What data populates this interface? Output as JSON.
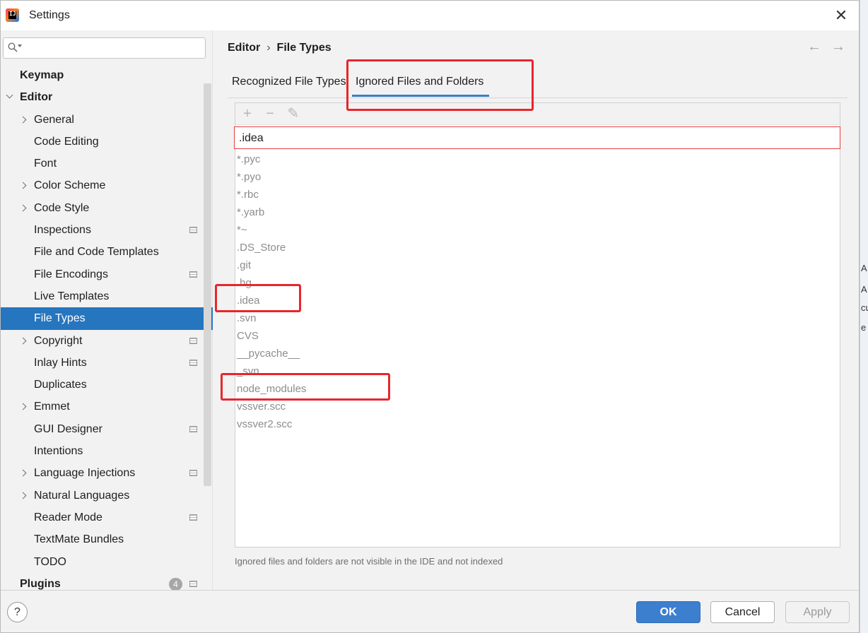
{
  "window": {
    "title": "Settings",
    "close_glyph": "✕"
  },
  "sidebar": {
    "search_placeholder": "",
    "items": [
      {
        "label": "Keymap",
        "bold": true,
        "level": 0,
        "chevron": "none",
        "scope": false
      },
      {
        "label": "Editor",
        "bold": true,
        "level": 0,
        "chevron": "down",
        "scope": false
      },
      {
        "label": "General",
        "level": 1,
        "chevron": "right",
        "scope": false
      },
      {
        "label": "Code Editing",
        "level": 1,
        "chevron": "none",
        "scope": false
      },
      {
        "label": "Font",
        "level": 1,
        "chevron": "none",
        "scope": false
      },
      {
        "label": "Color Scheme",
        "level": 1,
        "chevron": "right",
        "scope": false
      },
      {
        "label": "Code Style",
        "level": 1,
        "chevron": "right",
        "scope": false
      },
      {
        "label": "Inspections",
        "level": 1,
        "chevron": "none",
        "scope": true
      },
      {
        "label": "File and Code Templates",
        "level": 1,
        "chevron": "none",
        "scope": false
      },
      {
        "label": "File Encodings",
        "level": 1,
        "chevron": "none",
        "scope": true
      },
      {
        "label": "Live Templates",
        "level": 1,
        "chevron": "none",
        "scope": false
      },
      {
        "label": "File Types",
        "level": 1,
        "chevron": "none",
        "scope": false,
        "selected": true
      },
      {
        "label": "Copyright",
        "level": 1,
        "chevron": "right",
        "scope": true
      },
      {
        "label": "Inlay Hints",
        "level": 1,
        "chevron": "none",
        "scope": true
      },
      {
        "label": "Duplicates",
        "level": 1,
        "chevron": "none",
        "scope": false
      },
      {
        "label": "Emmet",
        "level": 1,
        "chevron": "right",
        "scope": false
      },
      {
        "label": "GUI Designer",
        "level": 1,
        "chevron": "none",
        "scope": true
      },
      {
        "label": "Intentions",
        "level": 1,
        "chevron": "none",
        "scope": false
      },
      {
        "label": "Language Injections",
        "level": 1,
        "chevron": "right",
        "scope": true
      },
      {
        "label": "Natural Languages",
        "level": 1,
        "chevron": "right",
        "scope": false
      },
      {
        "label": "Reader Mode",
        "level": 1,
        "chevron": "none",
        "scope": true
      },
      {
        "label": "TextMate Bundles",
        "level": 1,
        "chevron": "none",
        "scope": false
      },
      {
        "label": "TODO",
        "level": 1,
        "chevron": "none",
        "scope": false
      },
      {
        "label": "Plugins",
        "bold": true,
        "level": 0,
        "chevron": "none",
        "scope": true,
        "badge": "4"
      }
    ]
  },
  "breadcrumb": {
    "parent": "Editor",
    "separator": "›",
    "current": "File Types"
  },
  "nav": {
    "back": "←",
    "forward": "→"
  },
  "tabs": [
    {
      "label": "Recognized File Types",
      "active": false
    },
    {
      "label": "Ignored Files and Folders",
      "active": true
    }
  ],
  "toolbar": {
    "add": "+",
    "remove": "−",
    "edit": "✎"
  },
  "edit_field_value": ".idea",
  "patterns": [
    "*.pyc",
    "*.pyo",
    "*.rbc",
    "*.yarb",
    "*~",
    ".DS_Store",
    ".git",
    ".hg",
    ".idea",
    ".svn",
    "CVS",
    "__pycache__",
    "_svn",
    "node_modules",
    "vssver.scc",
    "vssver2.scc"
  ],
  "hint": "Ignored files and folders are not visible in the IDE and not indexed",
  "buttons": {
    "help": "?",
    "ok": "OK",
    "cancel": "Cancel",
    "apply": "Apply"
  },
  "colors": {
    "accent": "#3c7dc9",
    "selection": "#2675bf",
    "annotation": "#e8262b",
    "ok_button": "#3d7fcf"
  },
  "background_fragments": [
    "A",
    "A",
    "cu",
    "e"
  ]
}
